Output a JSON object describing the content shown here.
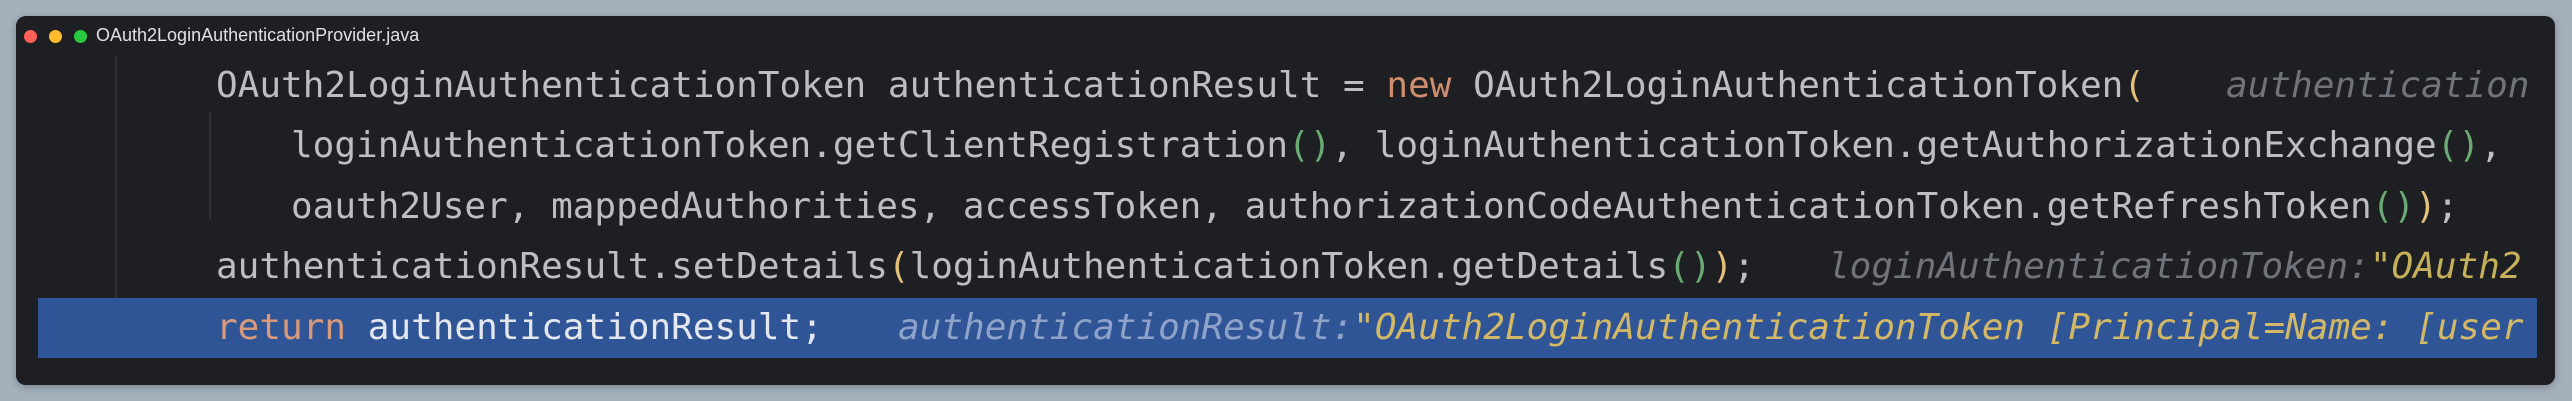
{
  "window": {
    "title": "OAuth2LoginAuthenticationProvider.java"
  },
  "colors": {
    "background": "#1e1f22",
    "keyword": "#cf8e6d",
    "highlight_line": "#2f5597",
    "hint_name": "#6f737a",
    "hint_value": "#c7b05a"
  },
  "code": {
    "line1": {
      "a": "OAuth2LoginAuthenticationToken authenticationResult = ",
      "kw": "new",
      "b": " OAuth2LoginAuthenticationToken",
      "paren": "(",
      "hint": "authentication"
    },
    "line2": {
      "a": "loginAuthenticationToken.getClientRegistration",
      "p1": "()",
      "b": ", loginAuthenticationToken.getAuthorizationExchange",
      "p2": "()",
      "c": ","
    },
    "line3": {
      "a": "oauth2User, mappedAuthorities, accessToken, authorizationCodeAuthenticationToken.getRefreshToken",
      "p1": "()",
      "p2": ")",
      "c": ";"
    },
    "line4": {
      "a": "authenticationResult.setDetails",
      "p_open": "(",
      "b": "loginAuthenticationToken.getDetails",
      "p_inner": "()",
      "p_close": ")",
      "c": ";",
      "hint_name": "loginAuthenticationToken:",
      "hint_value": "\"OAuth2"
    },
    "line5": {
      "kw": "return",
      "a": " authenticationResult;",
      "hint_name": "authenticationResult:",
      "hint_value": "\"OAuth2LoginAuthenticationToken [Principal=Name: [user"
    }
  }
}
